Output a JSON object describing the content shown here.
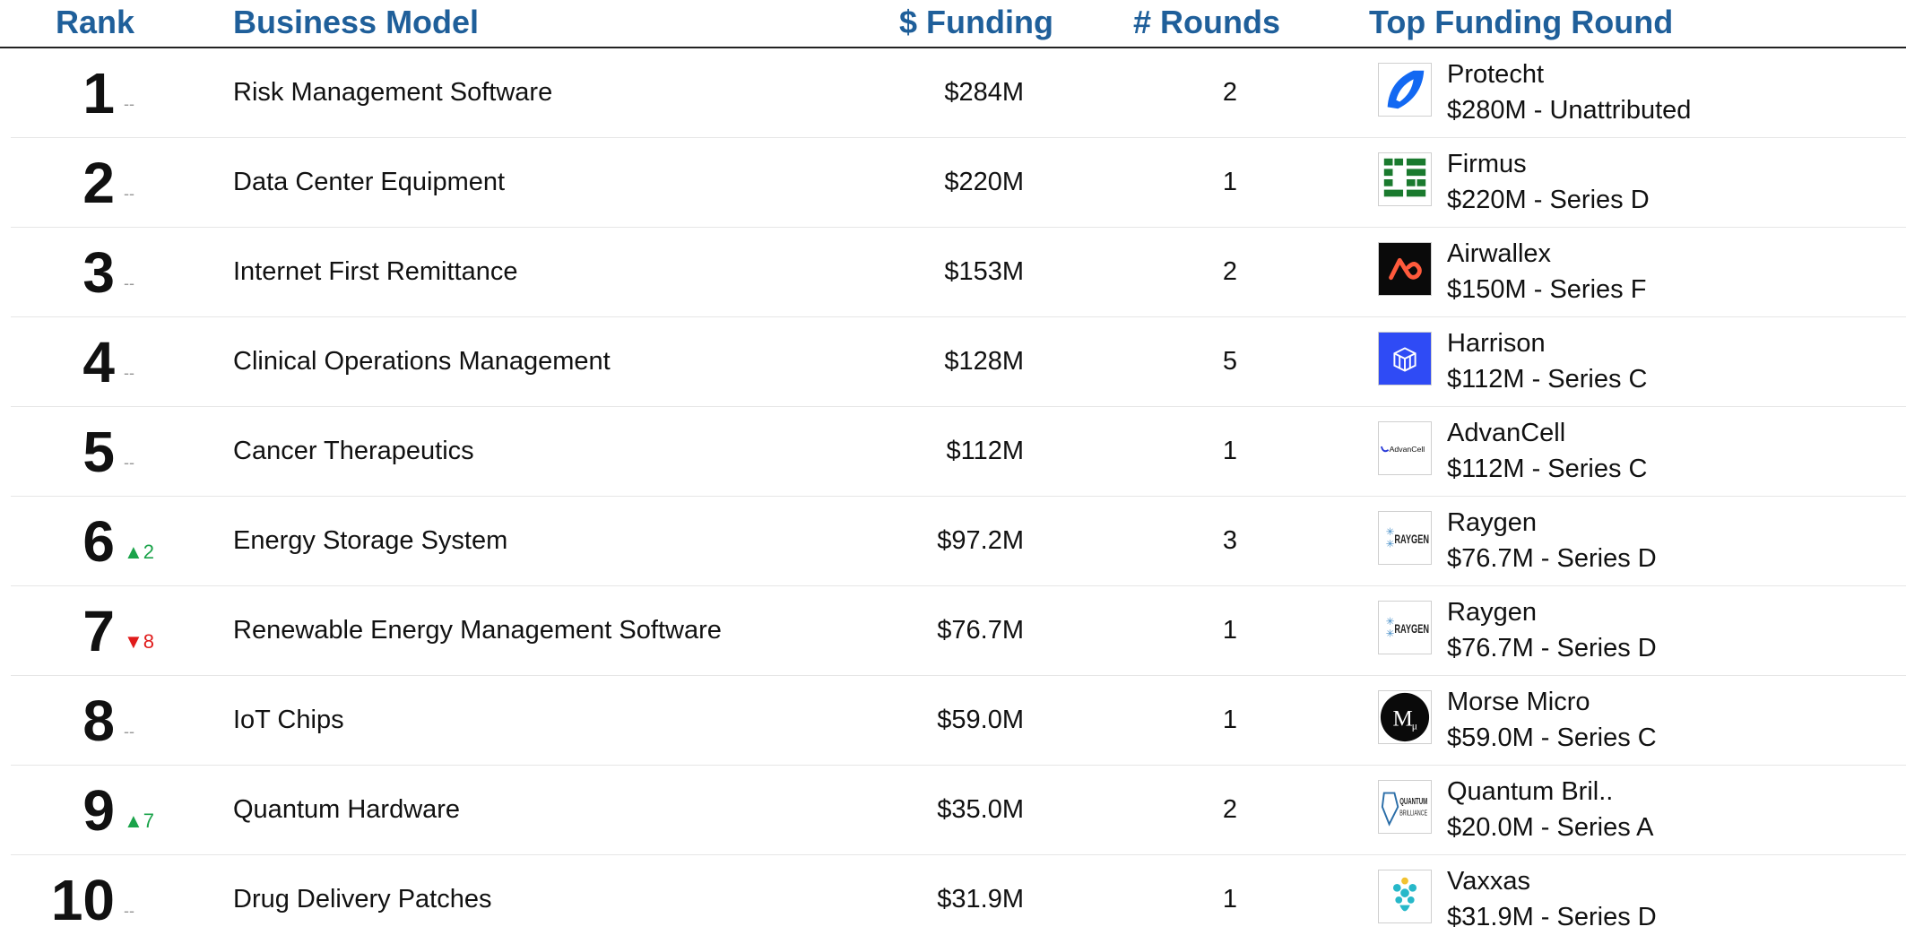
{
  "header": {
    "rank": "Rank",
    "business_model": "Business Model",
    "funding": "$ Funding",
    "rounds": "# Rounds",
    "top_round": "Top Funding Round"
  },
  "colors": {
    "header_text": "#1f5f9a",
    "up": "#1aa34a",
    "down": "#e01b1b",
    "neutral": "#999999"
  },
  "rows": [
    {
      "rank": "1",
      "change": "--",
      "change_dir": "same",
      "model": "Risk Management Software",
      "funding": "$284M",
      "rounds": "2",
      "company": "Protecht",
      "top_round": "$280M - Unattributed",
      "logo": "protecht-logo-icon"
    },
    {
      "rank": "2",
      "change": "--",
      "change_dir": "same",
      "model": "Data Center Equipment",
      "funding": "$220M",
      "rounds": "1",
      "company": "Firmus",
      "top_round": "$220M - Series D",
      "logo": "firmus-logo-icon"
    },
    {
      "rank": "3",
      "change": "--",
      "change_dir": "same",
      "model": "Internet First Remittance",
      "funding": "$153M",
      "rounds": "2",
      "company": "Airwallex",
      "top_round": "$150M - Series F",
      "logo": "airwallex-logo-icon"
    },
    {
      "rank": "4",
      "change": "--",
      "change_dir": "same",
      "model": "Clinical Operations Management",
      "funding": "$128M",
      "rounds": "5",
      "company": "Harrison",
      "top_round": "$112M - Series C",
      "logo": "harrison-logo-icon"
    },
    {
      "rank": "5",
      "change": "--",
      "change_dir": "same",
      "model": "Cancer Therapeutics",
      "funding": "$112M",
      "rounds": "1",
      "company": "AdvanCell",
      "top_round": "$112M - Series C",
      "logo": "advancell-logo-icon",
      "logo_text": "AdvanCell"
    },
    {
      "rank": "6",
      "change": "▲2",
      "change_dir": "up",
      "model": "Energy Storage System",
      "funding": "$97.2M",
      "rounds": "3",
      "company": "Raygen",
      "top_round": "$76.7M - Series D",
      "logo": "raygen-logo-icon",
      "logo_text": "RAYGEN"
    },
    {
      "rank": "7",
      "change": "▼8",
      "change_dir": "down",
      "model": "Renewable Energy Management Software",
      "funding": "$76.7M",
      "rounds": "1",
      "company": "Raygen",
      "top_round": "$76.7M - Series D",
      "logo": "raygen-logo-icon",
      "logo_text": "RAYGEN"
    },
    {
      "rank": "8",
      "change": "--",
      "change_dir": "same",
      "model": "IoT Chips",
      "funding": "$59.0M",
      "rounds": "1",
      "company": "Morse Micro",
      "top_round": "$59.0M - Series C",
      "logo": "morse-micro-logo-icon"
    },
    {
      "rank": "9",
      "change": "▲7",
      "change_dir": "up",
      "model": "Quantum Hardware",
      "funding": "$35.0M",
      "rounds": "2",
      "company": "Quantum Bril..",
      "top_round": "$20.0M - Series A",
      "logo": "quantum-brilliance-logo-icon",
      "logo_text": "QUANTUM BRILLIANCE"
    },
    {
      "rank": "10",
      "change": "--",
      "change_dir": "same",
      "model": "Drug Delivery Patches",
      "funding": "$31.9M",
      "rounds": "1",
      "company": "Vaxxas",
      "top_round": "$31.9M - Series D",
      "logo": "vaxxas-logo-icon"
    }
  ]
}
